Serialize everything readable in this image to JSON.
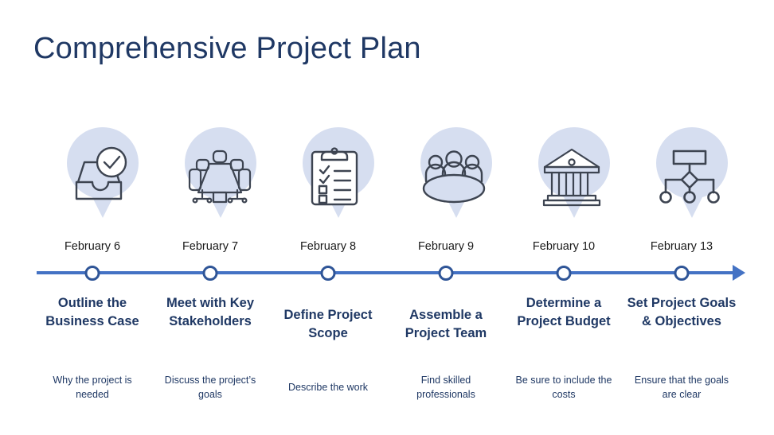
{
  "slide": {
    "title": "Comprehensive Project Plan",
    "colors": {
      "title": "#1F3864",
      "timeline": "#4472C4",
      "marker_border": "#2F5597",
      "pin_fill": "#D6DEF0",
      "icon_stroke": "#3D4451",
      "heading": "#1F3864",
      "description": "#1F3864",
      "date": "#1A1A1A",
      "background": "#FFFFFF"
    }
  },
  "timeline": {
    "arrow_direction": "right",
    "milestones": [
      {
        "date": "February 6",
        "heading": "Outline the Business Case",
        "description": "Why the project is needed",
        "icon": "inbox-check-icon",
        "heading_lines": 3,
        "desc_lines": 2
      },
      {
        "date": "February 7",
        "heading": "Meet with Key Stakeholders",
        "description": "Discuss the project’s goals",
        "icon": "conference-table-icon",
        "heading_lines": 3,
        "desc_lines": 2
      },
      {
        "date": "February 8",
        "heading": "Define Project Scope",
        "description": "Describe the work",
        "icon": "clipboard-checklist-icon",
        "heading_lines": 2,
        "desc_lines": 1
      },
      {
        "date": "February 9",
        "heading": "Assemble a Project Team",
        "description": "Find skilled professionals",
        "icon": "team-table-icon",
        "heading_lines": 2,
        "desc_lines": 2
      },
      {
        "date": "February 10",
        "heading": "Determine a Project Budget",
        "description": "Be sure to include the costs",
        "icon": "bank-building-icon",
        "heading_lines": 3,
        "desc_lines": 2
      },
      {
        "date": "February 13",
        "heading": "Set Project Goals & Objectives",
        "description": "Ensure that the goals are clear",
        "icon": "org-chart-icon",
        "heading_lines": 3,
        "desc_lines": 2
      }
    ]
  }
}
